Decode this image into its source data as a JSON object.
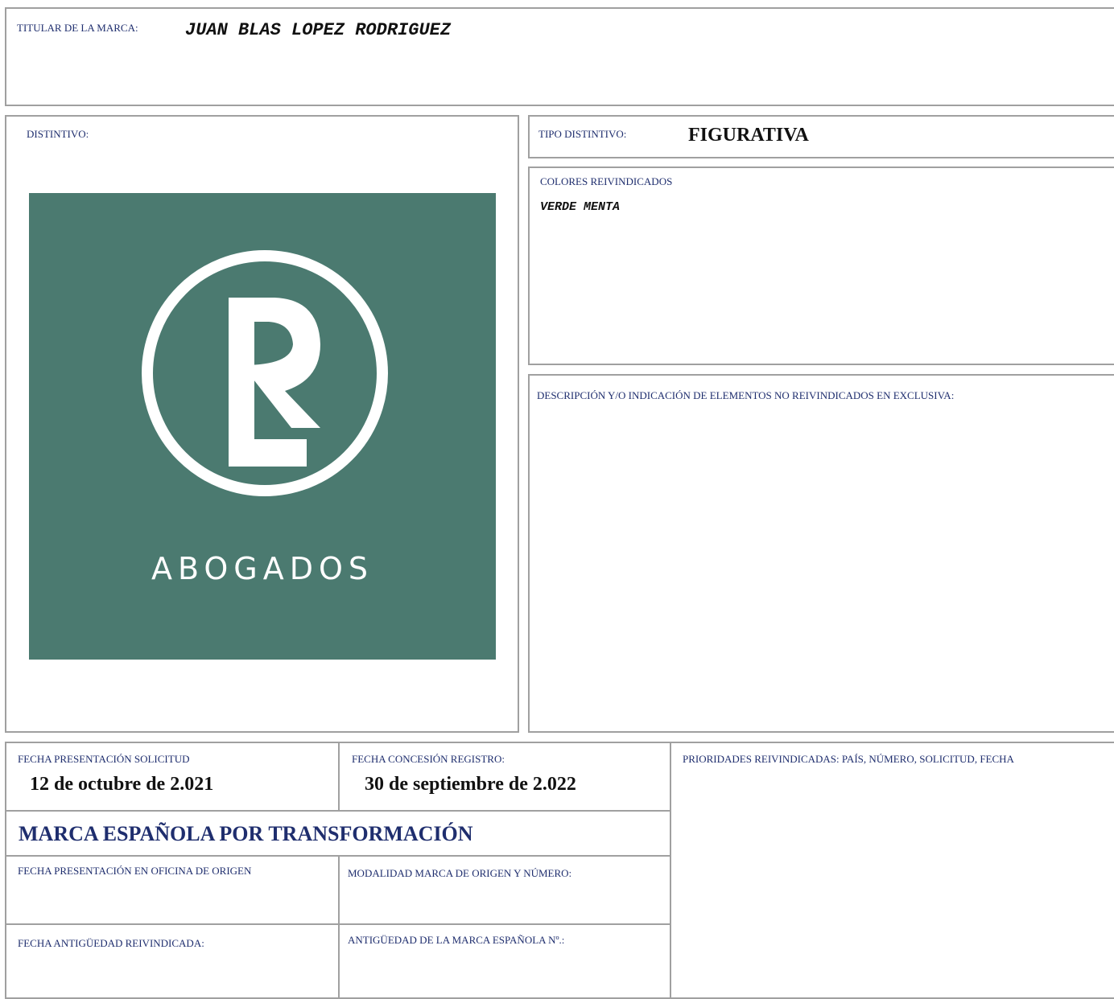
{
  "titular": {
    "label": "TITULAR DE LA MARCA:",
    "value": "JUAN BLAS LOPEZ RODRIGUEZ"
  },
  "distintivo": {
    "label": "DISTINTIVO:",
    "logo_text": "ABOGADOS",
    "logo_monogram": "RL",
    "logo_color": "#4b7a70"
  },
  "tipo_distintivo": {
    "label": "TIPO DISTINTIVO:",
    "value": "FIGURATIVA"
  },
  "colores": {
    "label": "COLORES REIVINDICADOS",
    "value": "VERDE MENTA"
  },
  "descripcion": {
    "label": "DESCRIPCIÓN Y/O INDICACIÓN DE ELEMENTOS NO REIVINDICADOS EN EXCLUSIVA:"
  },
  "fecha_presentacion": {
    "label": "FECHA PRESENTACIÓN SOLICITUD",
    "value": "12 de octubre de 2.021"
  },
  "fecha_concesion": {
    "label": "FECHA CONCESIÓN REGISTRO:",
    "value": "30 de septiembre de 2.022"
  },
  "prioridades": {
    "label": "PRIORIDADES REIVINDICADAS: PAÍS, NÚMERO, SOLICITUD, FECHA"
  },
  "transformacion": {
    "title": "MARCA ESPAÑOLA POR TRANSFORMACIÓN"
  },
  "fecha_oficina_origen": {
    "label": "FECHA PRESENTACIÓN EN OFICINA DE ORIGEN"
  },
  "modalidad_origen": {
    "label": "MODALIDAD MARCA DE ORIGEN Y NÚMERO:"
  },
  "fecha_antiguedad": {
    "label": "FECHA ANTIGÜEDAD REIVINDICADA:"
  },
  "antiguedad_marca": {
    "label": "ANTIGÜEDAD DE LA MARCA ESPAÑOLA Nº.:"
  }
}
